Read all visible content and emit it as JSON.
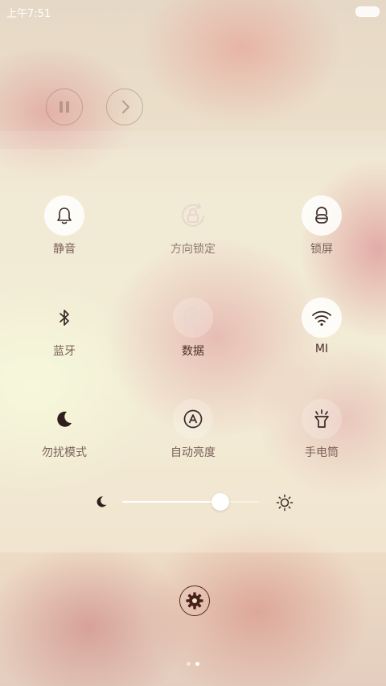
{
  "status_bar": {
    "time": "上午7:51",
    "battery_icon": "battery-icon"
  },
  "media": {
    "pause_icon": "pause-icon",
    "next_icon": "chevron-right-icon"
  },
  "toggles": [
    {
      "label": "静音",
      "icon": "bell-icon",
      "state": "on"
    },
    {
      "label": "方向锁定",
      "icon": "rotation-lock-icon",
      "state": "off"
    },
    {
      "label": "锁屏",
      "icon": "lock-icon",
      "state": "on"
    },
    {
      "label": "蓝牙",
      "icon": "bluetooth-icon",
      "state": "off"
    },
    {
      "label": "数据",
      "icon": "mobile-data-icon",
      "state": "dim"
    },
    {
      "label": "MI",
      "icon": "wifi-icon",
      "state": "on"
    },
    {
      "label": "勿扰模式",
      "icon": "moon-icon",
      "state": "off"
    },
    {
      "label": "自动亮度",
      "icon": "auto-brightness-icon",
      "state": "dim"
    },
    {
      "label": "手电筒",
      "icon": "flashlight-icon",
      "state": "dim"
    }
  ],
  "brightness": {
    "level_percent": 72,
    "min_icon": "moon-small-icon",
    "max_icon": "sun-icon"
  },
  "settings": {
    "icon": "gear-icon"
  },
  "pager": {
    "pages": 2,
    "active_index": 1
  },
  "colors": {
    "icon_dark": "#3a2a27",
    "icon_light": "#e6d4cc",
    "settings_border": "#5a2a22"
  }
}
